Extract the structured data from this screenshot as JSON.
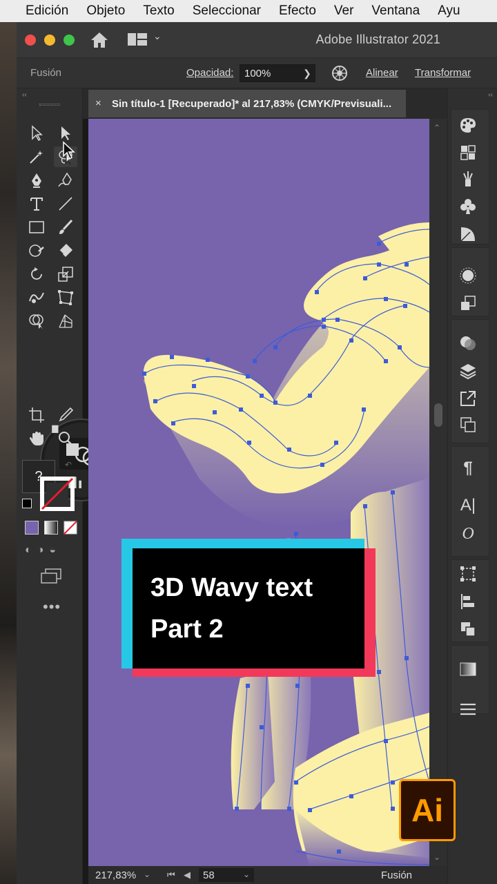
{
  "menubar": {
    "items": [
      "Edición",
      "Objeto",
      "Texto",
      "Seleccionar",
      "Efecto",
      "Ver",
      "Ventana",
      "Ayu"
    ]
  },
  "app": {
    "title": "Adobe Illustrator 2021"
  },
  "control_bar": {
    "blend_mode_label": "Fusión",
    "opacity_label": "Opacidad:",
    "opacity_value": "100%",
    "align_label": "Alinear",
    "transform_label": "Transformar"
  },
  "document": {
    "tab_title": "Sin título-1 [Recuperado]* al 217,83% (CMYK/Previsuali...",
    "close_glyph": "×"
  },
  "status_bar": {
    "zoom": "217,83%",
    "page": "58",
    "mode": "Fusión"
  },
  "overlay": {
    "line1": "3D Wavy text",
    "line2": "Part 2"
  },
  "logo": {
    "text": "Ai"
  },
  "colors": {
    "canvas": "#7764ad",
    "text_fill": "#fbf0a6",
    "path_blue": "#3d5bd9",
    "card_cyan": "#27c7e6",
    "card_red": "#f2395a",
    "ai_orange": "#ff9a00"
  },
  "icons": {
    "toolbar": [
      "selection-icon",
      "direct-selection-icon",
      "magic-wand-icon",
      "lasso-icon",
      "pen-icon",
      "curvature-icon",
      "type-icon",
      "line-icon",
      "rectangle-icon",
      "paintbrush-icon",
      "shaper-icon",
      "eraser-icon",
      "rotate-icon",
      "scale-icon",
      "warp-icon",
      "free-transform-icon",
      "shape-builder-icon",
      "perspective-grid-icon",
      "mesh-icon",
      "gradient-icon",
      "blend-icon",
      "eyedropper-icon",
      "column-graph-icon",
      "artboard-icon",
      "slice-icon",
      "hand-icon",
      "zoom-icon"
    ],
    "dock": [
      "color-icon",
      "swatches-icon",
      "brushes-icon",
      "symbols-icon",
      "graphic-styles-icon",
      "appearance-icon",
      "image-trace-icon",
      "transparency-icon",
      "layers-icon",
      "export-icon",
      "artboards-icon",
      "paragraph-icon",
      "character-icon",
      "opentype-icon",
      "transform-icon",
      "align-icon",
      "pathfinder-icon",
      "gradient-icon",
      "menu-icon"
    ]
  }
}
